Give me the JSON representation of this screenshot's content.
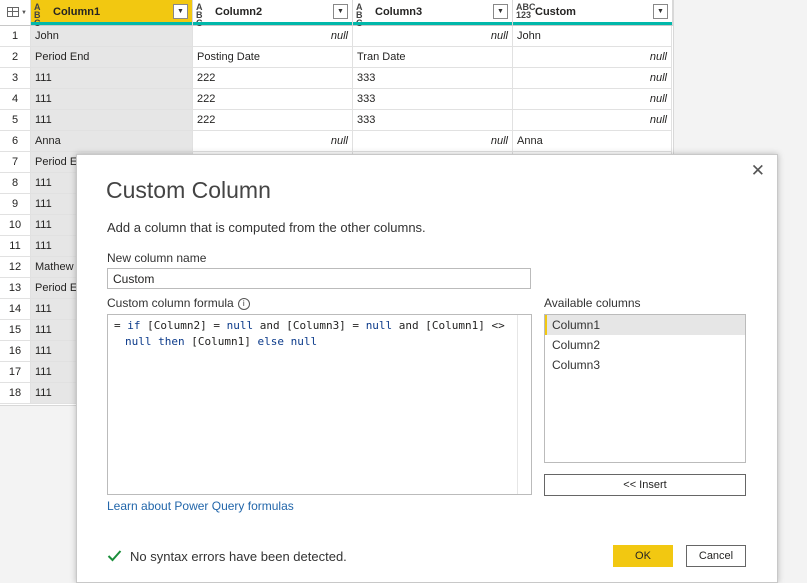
{
  "grid": {
    "columns": [
      {
        "type_top": "A",
        "type_mid": "B",
        "type_bot": "C",
        "name": "Column1",
        "quality_color": "#01b8aa",
        "active": true
      },
      {
        "type_top": "A",
        "type_mid": "B",
        "type_bot": "C",
        "name": "Column2",
        "quality_color": "#01b8aa",
        "active": false
      },
      {
        "type_top": "A",
        "type_mid": "B",
        "type_bot": "C",
        "name": "Column3",
        "quality_color": "#01b8aa",
        "active": false
      },
      {
        "type_top": "ABC",
        "type_mid": "123",
        "type_bot": "",
        "name": "Custom",
        "quality_color": "#01b8aa",
        "active": false
      }
    ],
    "rows": [
      [
        "1",
        "John",
        "null",
        "null",
        "John"
      ],
      [
        "2",
        "Period End",
        "Posting Date",
        "Tran Date",
        "null"
      ],
      [
        "3",
        "111",
        "222",
        "333",
        "null"
      ],
      [
        "4",
        "111",
        "222",
        "333",
        "null"
      ],
      [
        "5",
        "111",
        "222",
        "333",
        "null"
      ],
      [
        "6",
        "Anna",
        "null",
        "null",
        "Anna"
      ],
      [
        "7",
        "Period E",
        "",
        "",
        ""
      ],
      [
        "8",
        "111",
        "",
        "",
        ""
      ],
      [
        "9",
        "111",
        "",
        "",
        ""
      ],
      [
        "10",
        "111",
        "",
        "",
        ""
      ],
      [
        "11",
        "111",
        "",
        "",
        ""
      ],
      [
        "12",
        "Mathew",
        "",
        "",
        ""
      ],
      [
        "13",
        "Period E",
        "",
        "",
        ""
      ],
      [
        "14",
        "111",
        "",
        "",
        ""
      ],
      [
        "15",
        "111",
        "",
        "",
        ""
      ],
      [
        "16",
        "111",
        "",
        "",
        ""
      ],
      [
        "17",
        "111",
        "",
        "",
        ""
      ],
      [
        "18",
        "111",
        "",
        "",
        ""
      ]
    ]
  },
  "dialog": {
    "title": "Custom Column",
    "description": "Add a column that is computed from the other columns.",
    "new_column_label": "New column name",
    "new_column_value": "Custom",
    "formula_label": "Custom column formula",
    "info_glyph": "i",
    "formula_line1_parts": [
      "= ",
      "if",
      " [Column2] = ",
      "null",
      " and [Column3] = ",
      "null",
      " and [Column1] <>"
    ],
    "formula_line2_parts": [
      "null",
      " then",
      " [Column1] ",
      "else",
      " ",
      "null"
    ],
    "available_label": "Available columns",
    "available_columns": [
      "Column1",
      "Column2",
      "Column3"
    ],
    "insert_label": "<< Insert",
    "learn_link": "Learn about Power Query formulas",
    "status": "No syntax errors have been detected.",
    "ok_label": "OK",
    "cancel_label": "Cancel",
    "close_glyph": "✕"
  },
  "colors": {
    "accent": "#f2c811",
    "ok": "#1a8e3a",
    "link": "#2266aa"
  }
}
